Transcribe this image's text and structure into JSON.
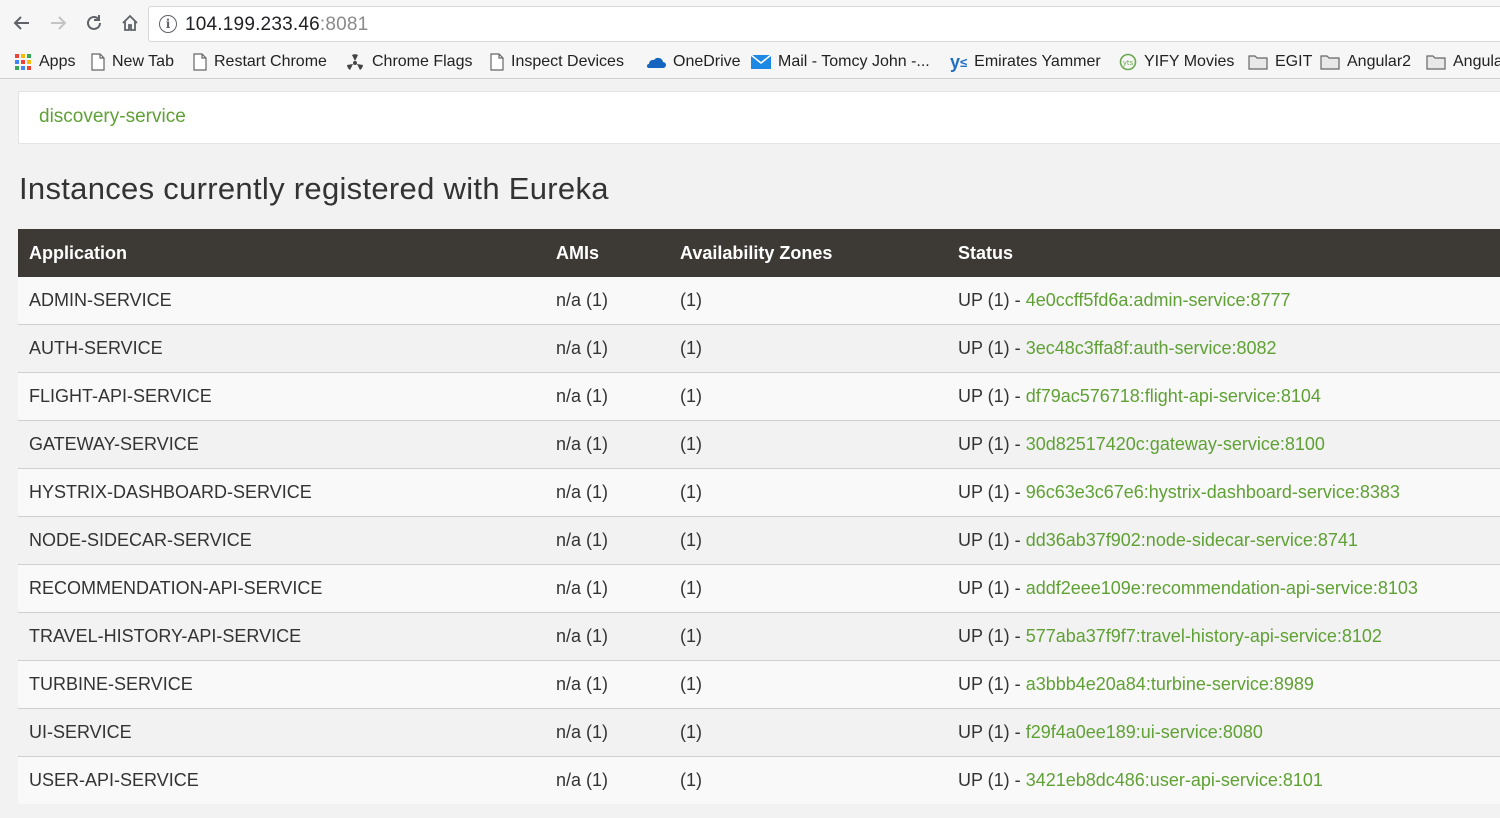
{
  "browser": {
    "url_host": "104.199.233.46",
    "url_port": ":8081",
    "bookmarks": [
      {
        "label": "Apps",
        "icon": "apps-grid-icon"
      },
      {
        "label": "New Tab",
        "icon": "page-icon"
      },
      {
        "label": "Restart Chrome",
        "icon": "page-icon"
      },
      {
        "label": "Chrome Flags",
        "icon": "radiation-icon"
      },
      {
        "label": "Inspect Devices",
        "icon": "page-icon"
      },
      {
        "label": "OneDrive",
        "icon": "cloud-icon"
      },
      {
        "label": "Mail - Tomcy John -...",
        "icon": "mail-icon"
      },
      {
        "label": "Emirates Yammer",
        "icon": "yammer-icon"
      },
      {
        "label": "YIFY Movies",
        "icon": "yify-icon"
      },
      {
        "label": "EGIT",
        "icon": "folder-icon"
      },
      {
        "label": "Angular2",
        "icon": "folder-icon"
      },
      {
        "label": "Angula",
        "icon": "folder-icon"
      }
    ]
  },
  "page": {
    "brand": "discovery-service",
    "heading": "Instances currently registered with Eureka",
    "table": {
      "headers": [
        "Application",
        "AMIs",
        "Availability Zones",
        "Status"
      ],
      "rows": [
        {
          "app": "ADMIN-SERVICE",
          "amis": "n/a (1)",
          "zones": "(1)",
          "status": "UP (1) - ",
          "link": "4e0ccff5fd6a:admin-service:8777"
        },
        {
          "app": "AUTH-SERVICE",
          "amis": "n/a (1)",
          "zones": "(1)",
          "status": "UP (1) - ",
          "link": "3ec48c3ffa8f:auth-service:8082"
        },
        {
          "app": "FLIGHT-API-SERVICE",
          "amis": "n/a (1)",
          "zones": "(1)",
          "status": "UP (1) - ",
          "link": "df79ac576718:flight-api-service:8104"
        },
        {
          "app": "GATEWAY-SERVICE",
          "amis": "n/a (1)",
          "zones": "(1)",
          "status": "UP (1) - ",
          "link": "30d82517420c:gateway-service:8100"
        },
        {
          "app": "HYSTRIX-DASHBOARD-SERVICE",
          "amis": "n/a (1)",
          "zones": "(1)",
          "status": "UP (1) - ",
          "link": "96c63e3c67e6:hystrix-dashboard-service:8383"
        },
        {
          "app": "NODE-SIDECAR-SERVICE",
          "amis": "n/a (1)",
          "zones": "(1)",
          "status": "UP (1) - ",
          "link": "dd36ab37f902:node-sidecar-service:8741"
        },
        {
          "app": "RECOMMENDATION-API-SERVICE",
          "amis": "n/a (1)",
          "zones": "(1)",
          "status": "UP (1) - ",
          "link": "addf2eee109e:recommendation-api-service:8103"
        },
        {
          "app": "TRAVEL-HISTORY-API-SERVICE",
          "amis": "n/a (1)",
          "zones": "(1)",
          "status": "UP (1) - ",
          "link": "577aba37f9f7:travel-history-api-service:8102"
        },
        {
          "app": "TURBINE-SERVICE",
          "amis": "n/a (1)",
          "zones": "(1)",
          "status": "UP (1) - ",
          "link": "a3bbb4e20a84:turbine-service:8989"
        },
        {
          "app": "UI-SERVICE",
          "amis": "n/a (1)",
          "zones": "(1)",
          "status": "UP (1) - ",
          "link": "f29f4a0ee189:ui-service:8080"
        },
        {
          "app": "USER-API-SERVICE",
          "amis": "n/a (1)",
          "zones": "(1)",
          "status": "UP (1) - ",
          "link": "3421eb8dc486:user-api-service:8101"
        }
      ]
    }
  },
  "colors": {
    "link_green": "#5fa134",
    "header_bg": "#3d3935",
    "page_bg": "#f2f2f2"
  }
}
